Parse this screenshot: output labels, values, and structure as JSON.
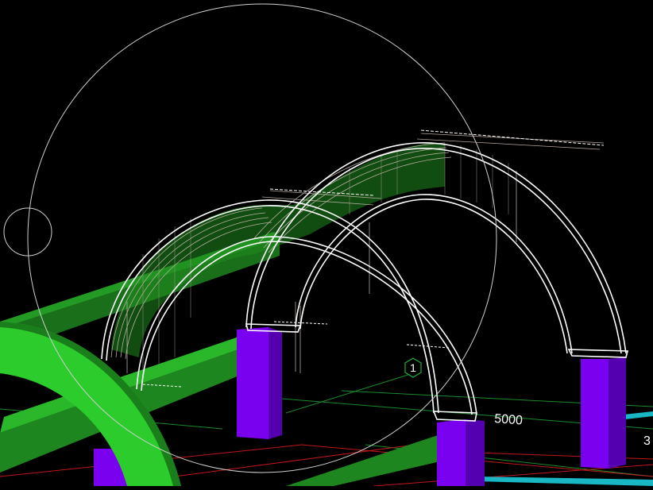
{
  "viewport": {
    "background": "#000000",
    "grid_marker_label": "1",
    "dimension_label": "5000",
    "edge_dimension_label": "3",
    "colors": {
      "arch_outline": "#ffffff",
      "rebar": "#c8b8b0",
      "column": "#7a00f0",
      "column_side": "#5500b0",
      "beam_green": "#1f8c1f",
      "beam_top": "#2ccc2c",
      "grid_red": "#c01818",
      "grid_green": "#1a8a2a",
      "cyan_beam": "#19b7c4",
      "orbit_circle": "#cfcfcf"
    }
  }
}
